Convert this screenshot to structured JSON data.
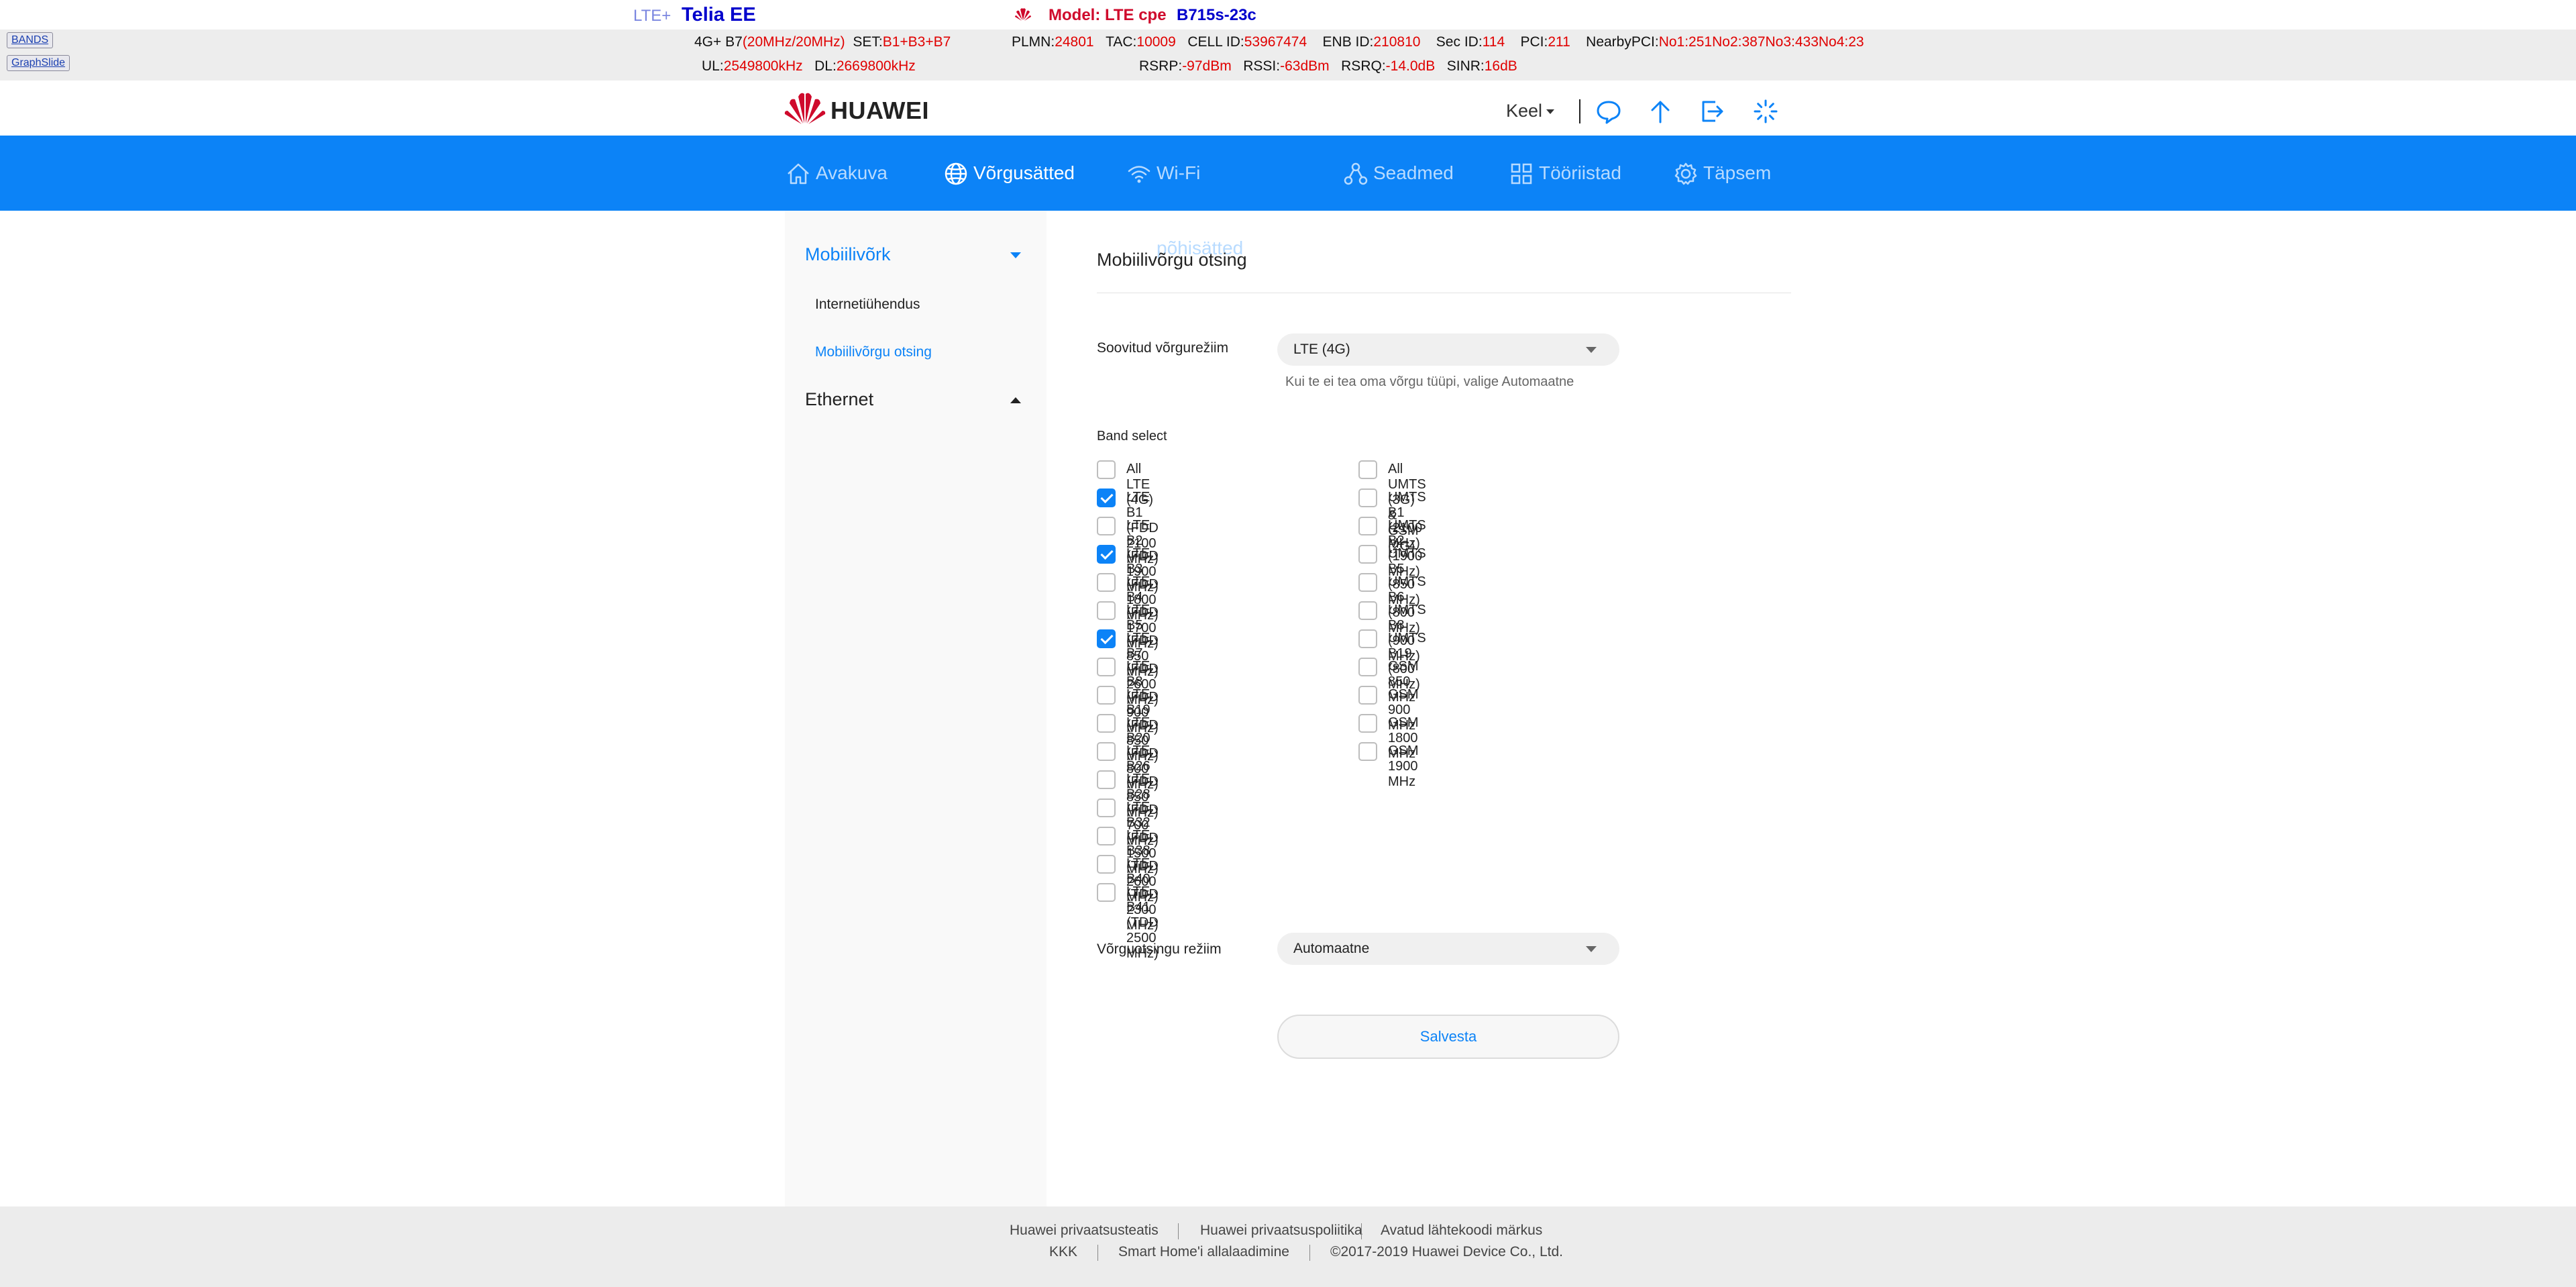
{
  "status_overlay": {
    "bands_button": "BANDS",
    "graphslide_button": "GraphSlide",
    "network_tech": "LTE+",
    "operator": "Telia EE",
    "model_label": "Model: LTE cpe",
    "model_name": "B715s-23c",
    "band_prefix": "4G+ B7",
    "bandwidth": "(20MHz/20MHz)",
    "set_label": "SET:",
    "set_value": "B1+B3+B7",
    "plmn_label": "PLMN:",
    "plmn_value": "24801",
    "tac_label": "TAC:",
    "tac_value": "10009",
    "cellid_label": "CELL ID:",
    "cellid_value": "53967474",
    "enb_label": "ENB ID:",
    "enb_value": "210810",
    "secid_label": "Sec ID:",
    "secid_value": "114",
    "pci_label": "PCI:",
    "pci_value": "211",
    "nearby_label": "NearbyPCI:",
    "nearby_value": "No1:251No2:387No3:433No4:23",
    "ul_label": "UL:",
    "ul_value": "2549800kHz",
    "dl_label": "DL:",
    "dl_value": "2669800kHz",
    "rsrp_label": "RSRP:",
    "rsrp_value": "-97dBm",
    "rssi_label": "RSSI:",
    "rssi_value": "-63dBm",
    "rsrq_label": "RSRQ:",
    "rsrq_value": "-14.0dB",
    "sinr_label": "SINR:",
    "sinr_value": "16dB"
  },
  "header": {
    "logo_text": "HUAWEI",
    "language_label": "Keel",
    "icons": [
      "message-icon",
      "upload-icon",
      "logout-icon",
      "loading-icon"
    ]
  },
  "nav": {
    "items": [
      {
        "label": "Avakuva",
        "icon": "home-icon"
      },
      {
        "label": "Võrgusätted",
        "icon": "globe-icon"
      },
      {
        "label": "Wi-Fi põhisätted",
        "icon": "wifi-icon"
      },
      {
        "label": "Seadmed",
        "icon": "devices-icon"
      },
      {
        "label": "Tööriistad",
        "icon": "tools-icon"
      },
      {
        "label": "Täpsem",
        "icon": "settings-icon"
      }
    ],
    "active_index": 1
  },
  "sidebar": {
    "sections": [
      {
        "label": "Mobiilivõrk",
        "expanded": true,
        "items": [
          "Internetiühendus",
          "Mobiilivõrgu otsing"
        ],
        "active_item": 1
      },
      {
        "label": "Ethernet",
        "expanded": false
      }
    ]
  },
  "main": {
    "title": "Mobiilivõrgu otsing",
    "preferred_mode_label": "Soovitud võrgurežiim",
    "preferred_mode_value": "LTE (4G)",
    "preferred_mode_hint": "Kui te ei tea oma võrgu tüüpi, valige Automaatne",
    "band_select_label": "Band select",
    "lte_bands": [
      {
        "label": "All LTE (4G)",
        "checked": false
      },
      {
        "label": "LTE B1 (FDD 2100 MHz)",
        "checked": true
      },
      {
        "label": "LTE B2 (FDD 1900 MHz)",
        "checked": false
      },
      {
        "label": "LTE B3 (FDD 1800 MHz)",
        "checked": true
      },
      {
        "label": "LTE B4 (FDD 1700 MHz)",
        "checked": false
      },
      {
        "label": "LTE B5 (FDD 850 MHz)",
        "checked": false
      },
      {
        "label": "LTE B7 (FDD 2600 MHz)",
        "checked": true
      },
      {
        "label": "LTE B8 (FDD 900 MHz)",
        "checked": false
      },
      {
        "label": "LTE B19 (FDD 850 MHz)",
        "checked": false
      },
      {
        "label": "LTE B20 (FDD 800 MHz)",
        "checked": false
      },
      {
        "label": "LTE B26 (FDD 850 MHz)",
        "checked": false
      },
      {
        "label": "LTE B28 (FDD 700 MHz)",
        "checked": false
      },
      {
        "label": "LTE B32 (FDD 1500 MHz)",
        "checked": false
      },
      {
        "label": "LTE B38 (TDD 2600 MHz)",
        "checked": false
      },
      {
        "label": "LTE B40 (TDD 2300 MHz)",
        "checked": false
      },
      {
        "label": "LTE B41 (TDD 2500 MHz)",
        "checked": false
      }
    ],
    "umts_gsm_bands": [
      {
        "label": "All UMTS (3G) & GSM (2G)",
        "checked": false
      },
      {
        "label": "UMTS B1 (2100 MHz)",
        "checked": false
      },
      {
        "label": "UMTS B2 (1900 MHz)",
        "checked": false
      },
      {
        "label": "UMTS B5 (850 MHz)",
        "checked": false
      },
      {
        "label": "UMTS B6 (800 MHz)",
        "checked": false
      },
      {
        "label": "UMTS B8 (900 MHz)",
        "checked": false
      },
      {
        "label": "UMTS B19 (800 MHz)",
        "checked": false
      },
      {
        "label": "GSM 850 MHz",
        "checked": false
      },
      {
        "label": "GSM 900 MHz",
        "checked": false
      },
      {
        "label": "GSM 1800 MHz",
        "checked": false
      },
      {
        "label": "GSM 1900 MHz",
        "checked": false
      }
    ],
    "search_mode_label": "Võrguotsingu režiim",
    "search_mode_value": "Automaatne",
    "save_label": "Salvesta"
  },
  "footer": {
    "row1": [
      "Huawei privaatsusteatis",
      "Huawei privaatsuspoliitika",
      "Avatud lähtekoodi märkus"
    ],
    "row2": [
      "KKK",
      "Smart Home'i allalaadimine",
      "©2017-2019 Huawei Device Co., Ltd."
    ]
  },
  "colors": {
    "accent": "#0c83f7",
    "nav_bg": "#0c83f7",
    "value_red": "#e00000",
    "brand_red": "#cf0a2c",
    "operator_blue": "#0000cc"
  }
}
